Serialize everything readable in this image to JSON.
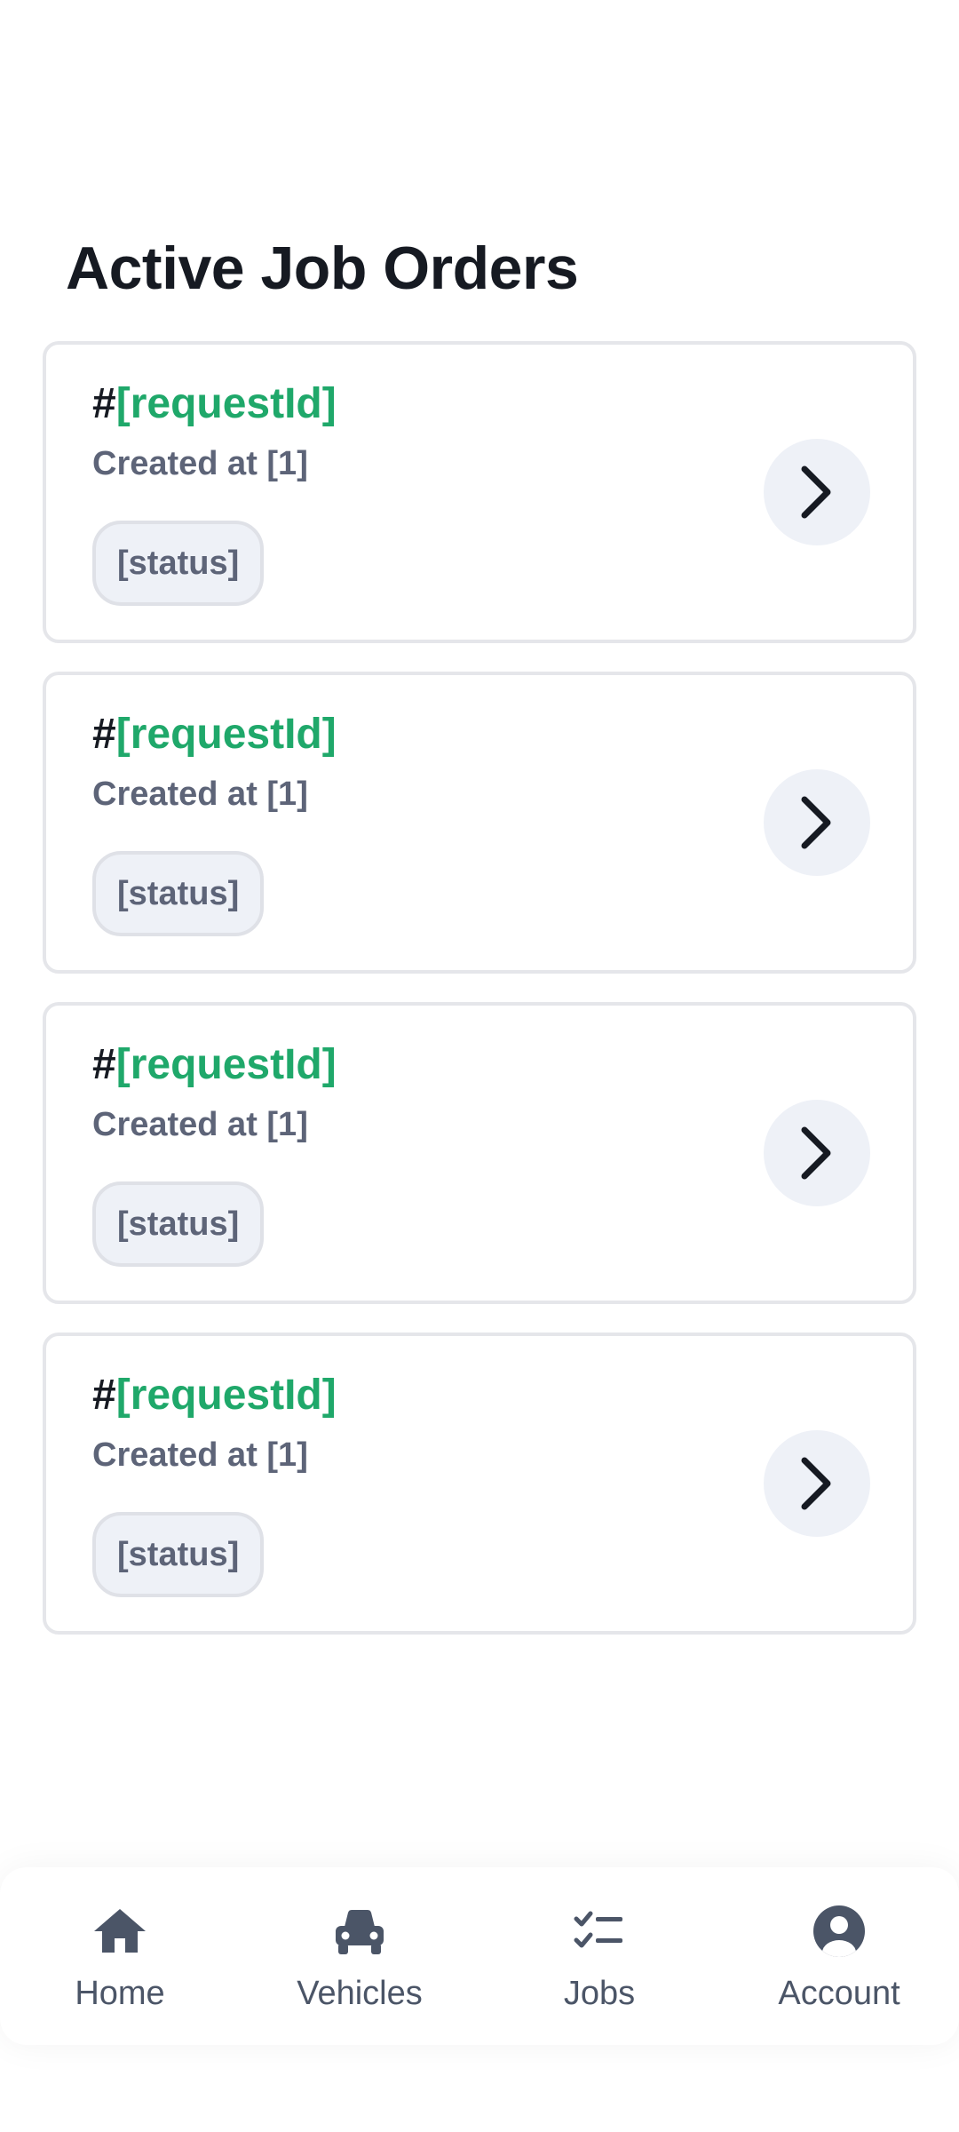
{
  "page": {
    "title": "Active Job Orders"
  },
  "jobs": [
    {
      "hash": "#",
      "request_id": "[requestId]",
      "created": "Created at [1]",
      "status": "[status]"
    },
    {
      "hash": "#",
      "request_id": "[requestId]",
      "created": "Created at [1]",
      "status": "[status]"
    },
    {
      "hash": "#",
      "request_id": "[requestId]",
      "created": "Created at [1]",
      "status": "[status]"
    },
    {
      "hash": "#",
      "request_id": "[requestId]",
      "created": "Created at [1]",
      "status": "[status]"
    }
  ],
  "nav": {
    "items": [
      {
        "label": "Home",
        "icon": "home-icon"
      },
      {
        "label": "Vehicles",
        "icon": "car-icon"
      },
      {
        "label": "Jobs",
        "icon": "checklist-icon"
      },
      {
        "label": "Account",
        "icon": "user-circle-icon"
      }
    ]
  },
  "colors": {
    "accent_green": "#1fa86a",
    "title_text": "#161a22",
    "muted_text": "#5d6478",
    "card_border": "#e5e6ea",
    "chip_bg": "#eef1f7",
    "nav_icon": "#4b5567"
  }
}
